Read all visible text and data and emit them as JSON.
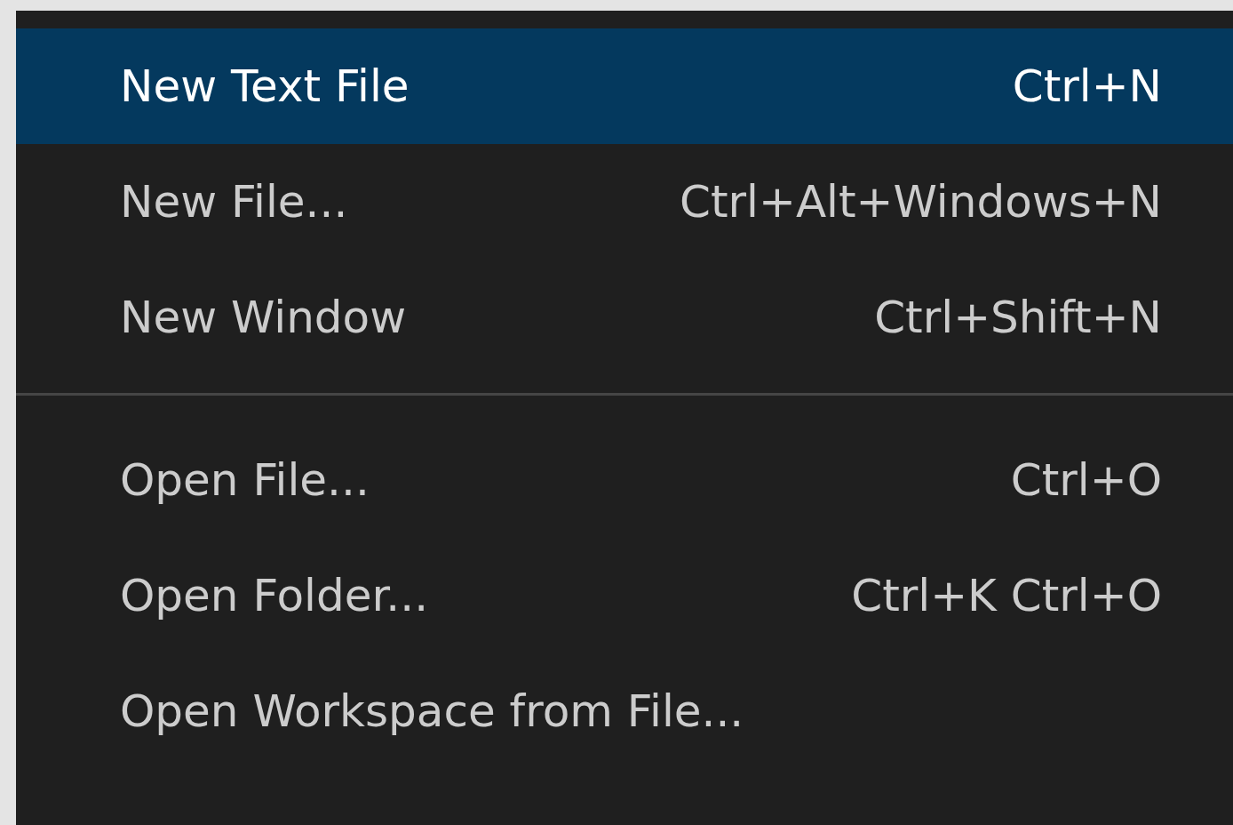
{
  "menu": {
    "groups": [
      {
        "items": [
          {
            "label": "New Text File",
            "shortcut": "Ctrl+N",
            "selected": true
          },
          {
            "label": "New File...",
            "shortcut": "Ctrl+Alt+Windows+N",
            "selected": false
          },
          {
            "label": "New Window",
            "shortcut": "Ctrl+Shift+N",
            "selected": false
          }
        ]
      },
      {
        "items": [
          {
            "label": "Open File...",
            "shortcut": "Ctrl+O",
            "selected": false
          },
          {
            "label": "Open Folder...",
            "shortcut": "Ctrl+K Ctrl+O",
            "selected": false
          },
          {
            "label": "Open Workspace from File...",
            "selected": false
          }
        ]
      }
    ]
  }
}
